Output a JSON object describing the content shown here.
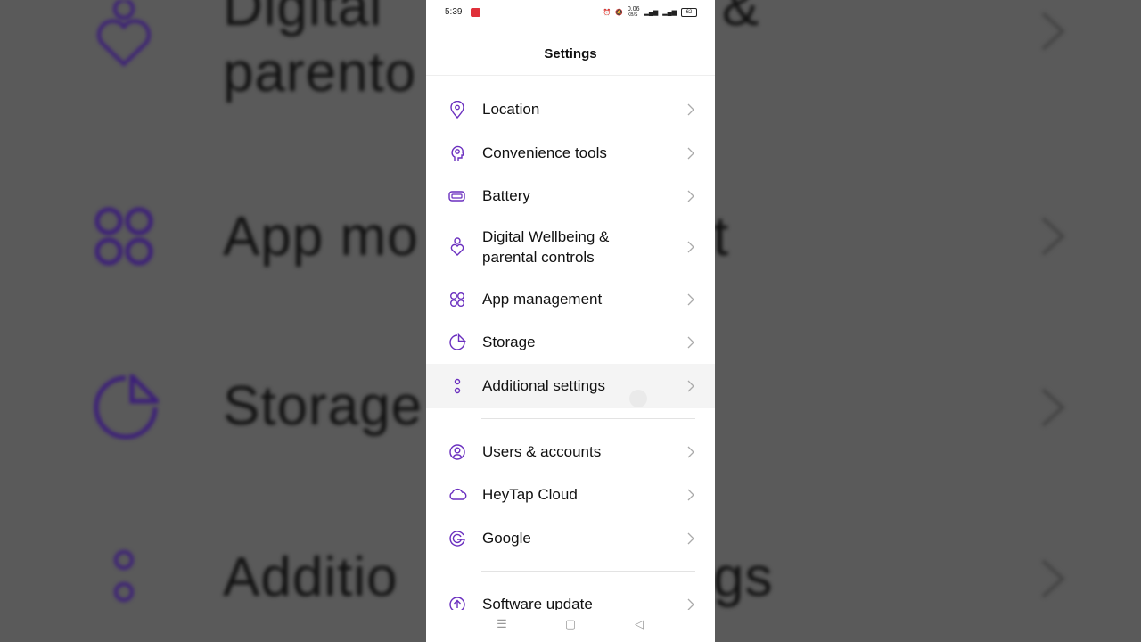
{
  "status_bar": {
    "time": "5:39",
    "net_speed": "0.06",
    "net_speed_unit": "KB/S",
    "battery": "62"
  },
  "header": {
    "title": "Settings"
  },
  "items": [
    {
      "label": "Location",
      "icon": "location-icon"
    },
    {
      "label": "Convenience tools",
      "icon": "convenience-tools-icon"
    },
    {
      "label": "Battery",
      "icon": "battery-icon"
    },
    {
      "label": "Digital Wellbeing &",
      "label2": "parental controls",
      "icon": "wellbeing-icon"
    },
    {
      "label": "App management",
      "icon": "app-management-icon"
    },
    {
      "label": "Storage",
      "icon": "storage-icon"
    },
    {
      "label": "Additional settings",
      "icon": "additional-settings-icon"
    },
    {
      "label": "Users & accounts",
      "icon": "users-icon"
    },
    {
      "label": "HeyTap Cloud",
      "icon": "cloud-icon"
    },
    {
      "label": "Google",
      "icon": "google-icon"
    },
    {
      "label": "Software update",
      "icon": "software-update-icon"
    }
  ],
  "background": {
    "line1": "Digital",
    "line1b": "&",
    "line2": "parento",
    "line3": "App mo",
    "line3b": "t",
    "line4": "Storage",
    "line5": "Additio",
    "line5b": "gs"
  },
  "colors": {
    "accent": "#6a2fbf",
    "text": "#111111",
    "divider": "#e3e3e3"
  }
}
